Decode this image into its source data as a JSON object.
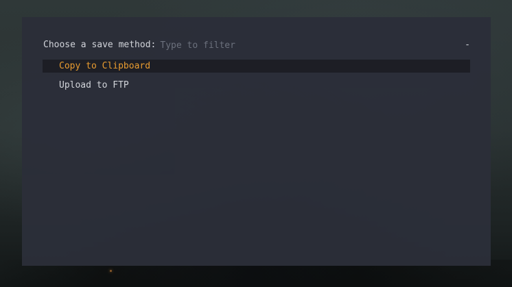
{
  "prompt": {
    "label": "Choose a save method:",
    "filter_value": "",
    "filter_placeholder": "Type to filter",
    "mode_indicator": "-"
  },
  "options": [
    {
      "label": "Copy to Clipboard",
      "selected": true
    },
    {
      "label": "Upload to FTP",
      "selected": false
    }
  ],
  "colors": {
    "window_background": "#2b2e39",
    "selected_row_background": "#1d1e25",
    "selected_text": "#f0a030",
    "text": "#d8dae0",
    "placeholder_text": "#6e7380"
  }
}
